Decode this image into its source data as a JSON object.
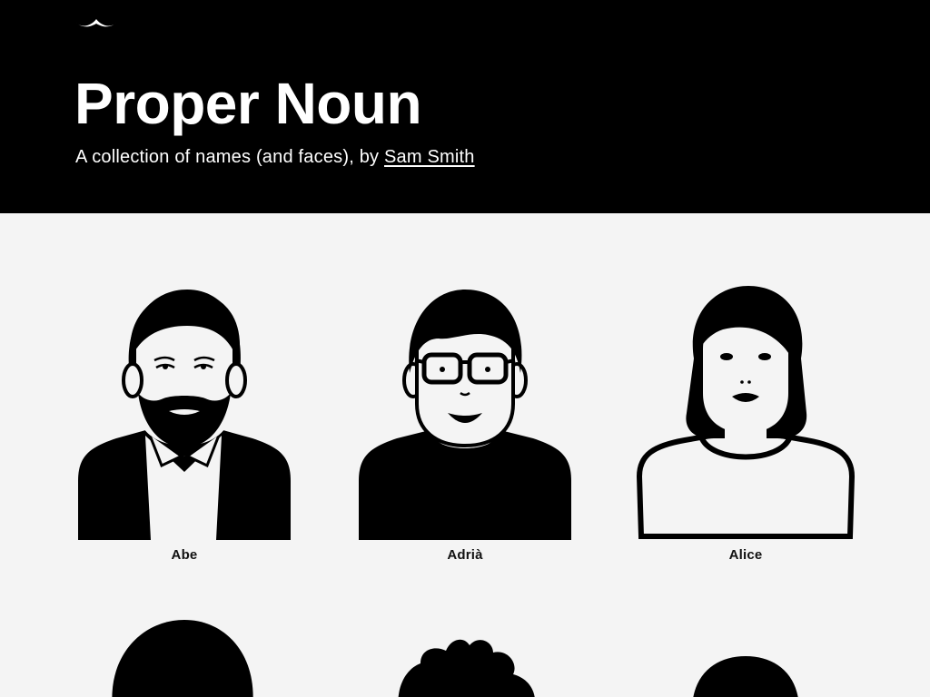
{
  "header": {
    "logo_icon": "mustache-icon",
    "title": "Proper Noun",
    "subtitle_prefix": "A collection of names (and faces), by ",
    "author_link": "Sam Smith"
  },
  "people": [
    {
      "name": "Abe",
      "icon": "avatar-abe-icon"
    },
    {
      "name": "Adrià",
      "icon": "avatar-adria-icon"
    },
    {
      "name": "Alice",
      "icon": "avatar-alice-icon"
    },
    {
      "name": "",
      "icon": "avatar-row2-1-icon"
    },
    {
      "name": "",
      "icon": "avatar-row2-2-icon"
    },
    {
      "name": "",
      "icon": "avatar-row2-3-icon"
    }
  ],
  "colors": {
    "header_bg": "#000000",
    "page_bg": "#f4f4f4",
    "ink": "#000000"
  }
}
